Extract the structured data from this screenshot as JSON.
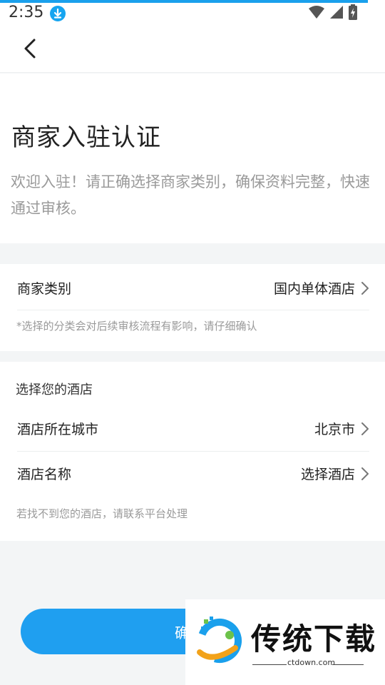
{
  "status_bar": {
    "time": "2:35",
    "icons": [
      "download-icon",
      "wifi-icon",
      "signal-icon",
      "battery-icon"
    ]
  },
  "nav": {
    "back_icon": "chevron-left-icon"
  },
  "intro": {
    "title": "商家入驻认证",
    "description": "欢迎入驻！请正确选择商家类别，确保资料完整，快速通过审核。"
  },
  "merchant_type": {
    "label": "商家类别",
    "value": "国内单体酒店",
    "note": "*选择的分类会对后续审核流程有影响，请仔细确认"
  },
  "hotel_section": {
    "heading": "选择您的酒店",
    "city_label": "酒店所在城市",
    "city_value": "北京市",
    "name_label": "酒店名称",
    "name_value": "选择酒店",
    "note": "若找不到您的酒店，请联系平台处理"
  },
  "confirm_button": {
    "label": "确认"
  },
  "watermark": {
    "title": "传统下载",
    "url": "ctdown.com"
  },
  "colors": {
    "accent": "#1f9ff0",
    "muted_text": "#9a9a9a",
    "page_bg": "#f3f5f6"
  }
}
